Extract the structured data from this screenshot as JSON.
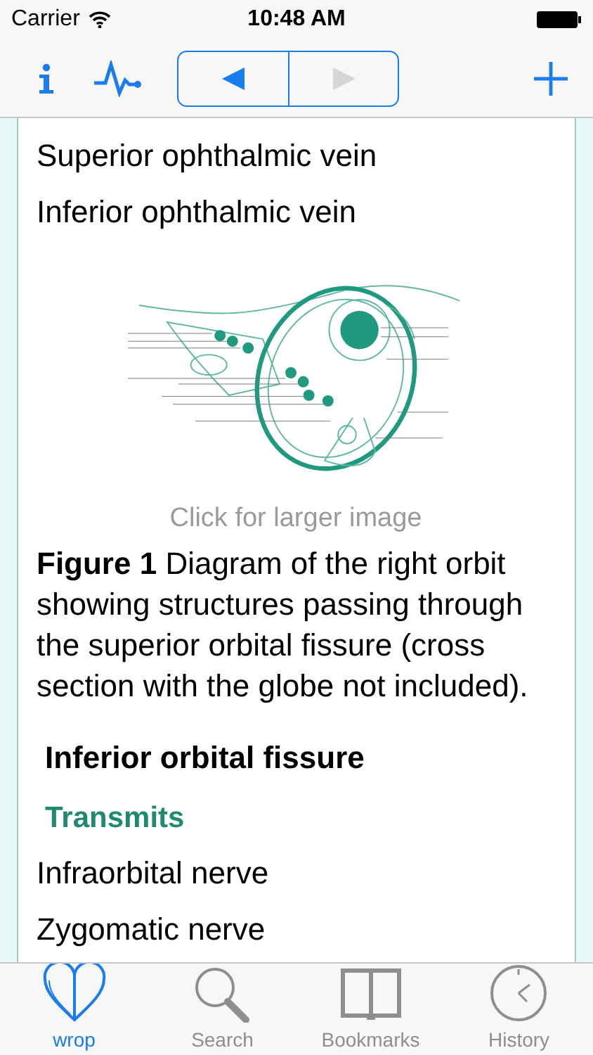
{
  "status_bar": {
    "carrier": "Carrier",
    "time": "10:48 AM"
  },
  "toolbar": {
    "segments": [
      {
        "kind": "back",
        "disabled": false
      },
      {
        "kind": "forward",
        "disabled": true
      }
    ]
  },
  "content": [
    {
      "kind": "item",
      "text": "Superior ophthalmic vein"
    },
    {
      "kind": "item",
      "text": "Inferior ophthalmic vein"
    },
    {
      "kind": "figure",
      "caption": "Click for larger image"
    },
    {
      "kind": "paragraph",
      "text": "**Figure 1** Diagram of the right orbit showing structures passing through the superior orbital fissure (cross section with the globe not included)."
    },
    {
      "kind": "heading",
      "text": "Inferior orbital fissure"
    },
    {
      "kind": "subheading",
      "text": "Transmits"
    },
    {
      "kind": "item",
      "text": "Infraorbital nerve"
    },
    {
      "kind": "item",
      "text": "Zygomatic nerve"
    }
  ],
  "tab_bar": [
    {
      "label": "wrop",
      "selected": true
    },
    {
      "label": "Search",
      "selected": false
    },
    {
      "label": "Bookmarks",
      "selected": false
    },
    {
      "label": "History",
      "selected": false
    }
  ]
}
